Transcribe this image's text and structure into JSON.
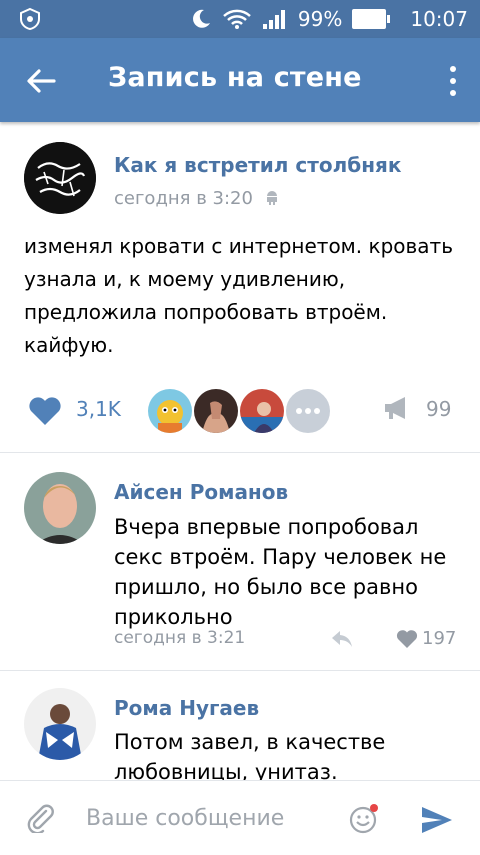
{
  "status_bar": {
    "battery_percent": "99%",
    "time": "10:07",
    "icons": [
      "shield-icon",
      "moon-icon",
      "wifi-icon",
      "signal-icon",
      "battery-icon"
    ]
  },
  "app_bar": {
    "title": "Запись на стене",
    "icons": [
      "back-arrow-icon",
      "more-vert-icon"
    ]
  },
  "post": {
    "author": "Как я встретил столбняк",
    "time": "сегодня в 3:20",
    "text": "изменял кровати с интернетом. кровать узнала и, к моему удивлению, предложила попробовать втроём. кайфую.",
    "likes": "3,1K",
    "reposts": "99",
    "logo_text": "Как я встретил столбняк"
  },
  "comments": [
    {
      "author": "Айсен Романов",
      "text": "Вчера впервые попробовал секс втроём. Пару человек не пришло, но было все равно прикольно",
      "time": "сегодня в 3:21",
      "likes": "197"
    },
    {
      "author": "Рома Нугаев",
      "text": "Потом завел, в качестве любовницы, унитаз."
    }
  ],
  "input": {
    "placeholder": "Ваше сообщение",
    "value": ""
  },
  "colors": {
    "status_bar": "#4a73a4",
    "app_bar": "#5181b8",
    "link": "#4a73a4",
    "muted": "#939aa3"
  }
}
